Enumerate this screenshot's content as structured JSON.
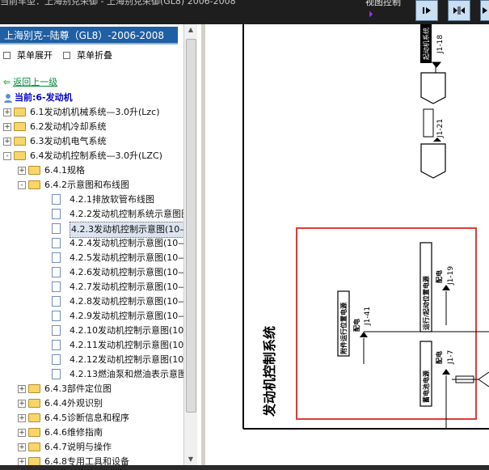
{
  "window": {
    "title": "当前车型：上海别克荣御 - 上海别克荣御(GL8) 2006-2008"
  },
  "toolbar": {
    "view_control_label": "视图控制",
    "icons": [
      "play-arrow-icon",
      "next-icon",
      "split-view-icon",
      "next-right-icon"
    ]
  },
  "nav": {
    "header": "上海别克--陆尊（GL8）-2006-2008",
    "expand_all": "菜单展开",
    "collapse_all": "菜单折叠",
    "back": "返回上一级",
    "current": "当前:6-发动机"
  },
  "tree": [
    {
      "label": "6.1发动机机械系统—3.0升(Lzc)",
      "level": 0,
      "type": "folder",
      "expander": "+"
    },
    {
      "label": "6.2发动机冷却系统",
      "level": 0,
      "type": "folder",
      "expander": "+"
    },
    {
      "label": "6.3发动机电气系统",
      "level": 0,
      "type": "folder",
      "expander": "+"
    },
    {
      "label": "6.4发动机控制系统—3.0升(LZC)",
      "level": 0,
      "type": "folder",
      "expander": "-"
    },
    {
      "label": "6.4.1规格",
      "level": 1,
      "type": "folder",
      "expander": "+"
    },
    {
      "label": "6.4.2示意图和布线图",
      "level": 1,
      "type": "folder",
      "expander": "-"
    },
    {
      "label": "4.2.1排放软管布线图",
      "level": 2,
      "type": "doc"
    },
    {
      "label": "4.2.2发动机控制系统示意图图",
      "level": 2,
      "type": "doc"
    },
    {
      "label": "4.2.3发动机控制示意图(10—1",
      "level": 2,
      "type": "doc",
      "selected": true
    },
    {
      "label": "4.2.4发动机控制示意图(10—2",
      "level": 2,
      "type": "doc"
    },
    {
      "label": "4.2.5发动机控制示意图(10—3",
      "level": 2,
      "type": "doc"
    },
    {
      "label": "4.2.6发动机控制示意图(10—4",
      "level": 2,
      "type": "doc"
    },
    {
      "label": "4.2.7发动机控制示意图(10—5",
      "level": 2,
      "type": "doc"
    },
    {
      "label": "4.2.8发动机控制示意图(10—6",
      "level": 2,
      "type": "doc"
    },
    {
      "label": "4.2.9发动机控制示意图(10—7",
      "level": 2,
      "type": "doc"
    },
    {
      "label": "4.2.10发动机控制示意图(10—",
      "level": 2,
      "type": "doc"
    },
    {
      "label": "4.2.11发动机控制示意图(10—",
      "level": 2,
      "type": "doc"
    },
    {
      "label": "4.2.12发动机控制示意图(10—",
      "level": 2,
      "type": "doc"
    },
    {
      "label": "4.2.13燃油泵和燃油表示意图",
      "level": 2,
      "type": "doc"
    },
    {
      "label": "6.4.3部件定位图",
      "level": 1,
      "type": "folder",
      "expander": "+"
    },
    {
      "label": "6.4.4外观识别",
      "level": 1,
      "type": "folder",
      "expander": "+"
    },
    {
      "label": "6.4.5诊断信息和程序",
      "level": 1,
      "type": "folder",
      "expander": "+"
    },
    {
      "label": "6.4.6维修指南",
      "level": 1,
      "type": "folder",
      "expander": "+"
    },
    {
      "label": "6.4.7说明与操作",
      "level": 1,
      "type": "folder",
      "expander": "+"
    },
    {
      "label": "6.4.8专用工具和设备",
      "level": 1,
      "type": "folder",
      "expander": "+"
    }
  ],
  "diagram": {
    "system_title": "发动机控制系统",
    "j1_18": "J1-18",
    "j1_18_label": "起动机系统",
    "j1_21": "J1-21",
    "j1_21_label": "配电",
    "j1_19": "J1-19",
    "j1_41": "J1-41",
    "j1_7": "J1-7",
    "power_dist": "配电",
    "label_a": "附件运行位置电源",
    "label_b": "运行/起动位置电源",
    "label_c": "蓄电池电源"
  },
  "colors": {
    "nav_header": "#1f5fa3",
    "highlight_box": "#e23a3a",
    "back_link": "#0a8a3a",
    "current_node": "#0000cc"
  }
}
